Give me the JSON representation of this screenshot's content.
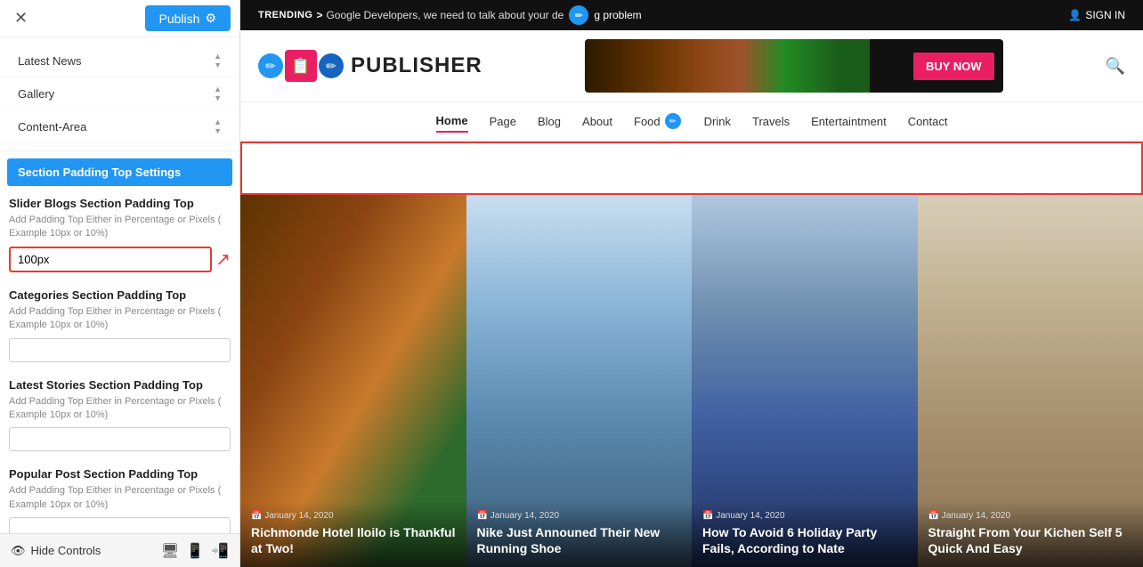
{
  "topBar": {
    "closeLabel": "✕",
    "publishLabel": "Publish",
    "gearLabel": "⚙"
  },
  "sidebarNav": [
    {
      "label": "Latest News",
      "arrows": true
    },
    {
      "label": "Gallery",
      "arrows": true
    },
    {
      "label": "Content-Area",
      "arrows": true
    }
  ],
  "sectionPaddingHeader": "Section Padding Top Settings",
  "settings": [
    {
      "id": "slider-blogs",
      "title": "Slider Blogs Section Padding Top",
      "desc": "Add Padding Top Either in Percentage or Pixels ( Example 10px or 10%)",
      "value": "100px",
      "active": true
    },
    {
      "id": "categories",
      "title": "Categories Section Padding Top",
      "desc": "Add Padding Top Either in Percentage or Pixels ( Example 10px or 10%)",
      "value": "",
      "active": false
    },
    {
      "id": "latest-stories",
      "title": "Latest Stories Section Padding Top",
      "desc": "Add Padding Top Either in Percentage or Pixels ( Example 10px or 10%)",
      "value": "",
      "active": false
    },
    {
      "id": "popular-post",
      "title": "Popular Post Section Padding Top",
      "desc": "Add Padding Top Either in Percentage or Pixels ( Example 10px or 10%)",
      "value": "",
      "active": false
    }
  ],
  "bottomBar": {
    "hideControlsLabel": "Hide Controls"
  },
  "preview": {
    "trendingLabel": "TRENDING",
    "trendingArrow": ">",
    "trendingMessage": "Google Developers, we need to talk about your de",
    "trendingPencilSuffix": "g problem",
    "signIn": "SIGN IN",
    "logoText": "PUBLISHER",
    "adBuyNow": "BUY NOW",
    "navItems": [
      {
        "label": "Home",
        "active": true
      },
      {
        "label": "Page",
        "active": false
      },
      {
        "label": "Blog",
        "active": false
      },
      {
        "label": "About",
        "active": false
      },
      {
        "label": "Food",
        "active": false
      },
      {
        "label": "Drink",
        "active": false
      },
      {
        "label": "Travels",
        "active": false
      },
      {
        "label": "Entertaintment",
        "active": false
      },
      {
        "label": "Contact",
        "active": false
      }
    ],
    "cards": [
      {
        "date": "January 14, 2020",
        "title": "Richmonde Hotel Iloilo is Thankful at Two!",
        "bg": "card-bg-1"
      },
      {
        "date": "January 14, 2020",
        "title": "Nike Just Announed Their New Running Shoe",
        "bg": "card-bg-2"
      },
      {
        "date": "January 14, 2020",
        "title": "How To Avoid 6 Holiday Party Fails, According to Nate",
        "bg": "card-bg-3"
      },
      {
        "date": "January 14, 2020",
        "title": "Straight From Your Kichen Self 5 Quick And Easy",
        "bg": "card-bg-4"
      }
    ]
  }
}
